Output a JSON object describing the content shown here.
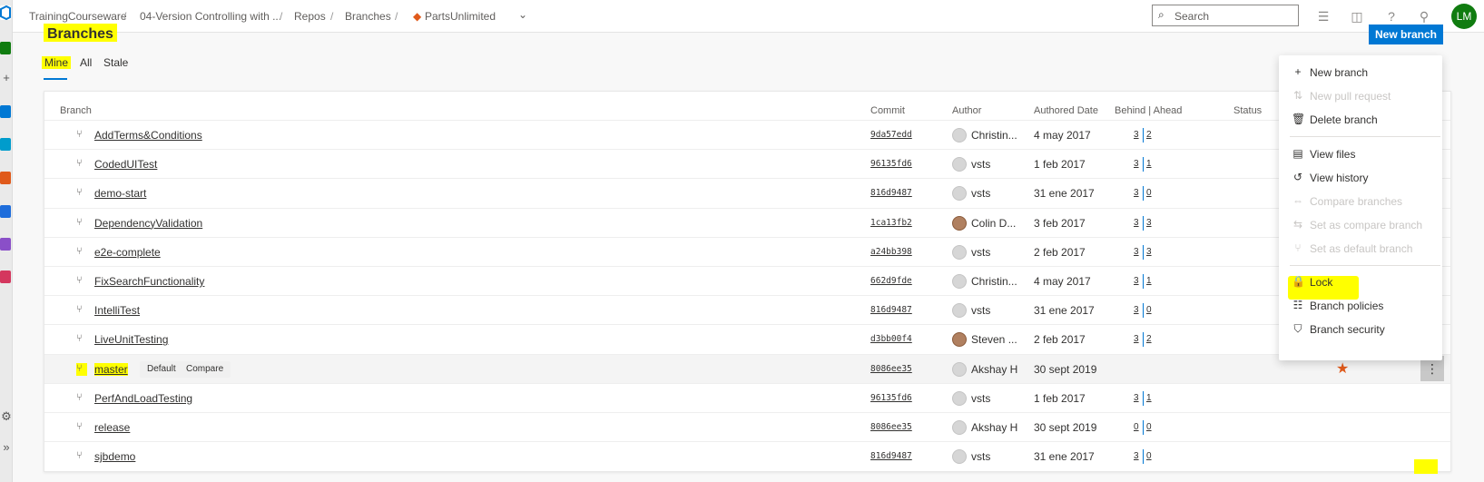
{
  "topbar": {
    "breadcrumbs": [
      "TrainingCourseware",
      "04-Version Controlling with ...",
      "Repos",
      "Branches",
      "PartsUnlimited"
    ],
    "search_placeholder": "Search",
    "user_initials": "LM"
  },
  "page": {
    "title": "Branches",
    "new_branch_label": "New branch",
    "tabs": [
      "Mine",
      "All",
      "Stale"
    ],
    "active_tab": "Mine"
  },
  "table": {
    "headers": [
      "Branch",
      "Commit",
      "Author",
      "Authored Date",
      "Behind | Ahead",
      "Status"
    ],
    "rows": [
      {
        "name": "AddTerms&Conditions",
        "commit": "9da57edd",
        "author": "Christin...",
        "date": "4 may 2017",
        "behind": "3",
        "ahead": "2"
      },
      {
        "name": "CodedUITest",
        "commit": "96135fd6",
        "author": "vsts",
        "date": "1 feb 2017",
        "behind": "3",
        "ahead": "1"
      },
      {
        "name": "demo-start",
        "commit": "816d9487",
        "author": "vsts",
        "date": "31 ene 2017",
        "behind": "3",
        "ahead": "0"
      },
      {
        "name": "DependencyValidation",
        "commit": "1ca13fb2",
        "author": "Colin D...",
        "date": "3 feb 2017",
        "behind": "3",
        "ahead": "3"
      },
      {
        "name": "e2e-complete",
        "commit": "a24bb398",
        "author": "vsts",
        "date": "2 feb 2017",
        "behind": "3",
        "ahead": "3"
      },
      {
        "name": "FixSearchFunctionality",
        "commit": "662d9fde",
        "author": "Christin...",
        "date": "4 may 2017",
        "behind": "3",
        "ahead": "1"
      },
      {
        "name": "IntelliTest",
        "commit": "816d9487",
        "author": "vsts",
        "date": "31 ene 2017",
        "behind": "3",
        "ahead": "0"
      },
      {
        "name": "LiveUnitTesting",
        "commit": "d3bb00f4",
        "author": "Steven ...",
        "date": "2 feb 2017",
        "behind": "3",
        "ahead": "2"
      },
      {
        "name": "master",
        "commit": "8086ee35",
        "author": "Akshay H",
        "date": "30 sept 2019",
        "behind": "",
        "ahead": "",
        "pills": [
          "Default",
          "Compare"
        ]
      },
      {
        "name": "PerfAndLoadTesting",
        "commit": "96135fd6",
        "author": "vsts",
        "date": "1 feb 2017",
        "behind": "3",
        "ahead": "1"
      },
      {
        "name": "release",
        "commit": "8086ee35",
        "author": "Akshay H",
        "date": "30 sept 2019",
        "behind": "0",
        "ahead": "0"
      },
      {
        "name": "sjbdemo",
        "commit": "816d9487",
        "author": "vsts",
        "date": "31 ene 2017",
        "behind": "3",
        "ahead": "0"
      }
    ]
  },
  "menu": {
    "items": [
      {
        "label": "New branch",
        "icon": "plus-icon",
        "disabled": false
      },
      {
        "label": "New pull request",
        "icon": "pull-request-icon",
        "disabled": true
      },
      {
        "label": "Delete branch",
        "icon": "trash-icon",
        "disabled": false
      },
      {
        "label": "View files",
        "icon": "file-icon",
        "disabled": false
      },
      {
        "label": "View history",
        "icon": "history-icon",
        "disabled": false
      },
      {
        "label": "Compare branches",
        "icon": "compare-icon",
        "disabled": true
      },
      {
        "label": "Set as compare branch",
        "icon": "compare-set-icon",
        "disabled": true
      },
      {
        "label": "Set as default branch",
        "icon": "branch-icon",
        "disabled": true
      },
      {
        "label": "Lock",
        "icon": "lock-icon",
        "disabled": false
      },
      {
        "label": "Branch policies",
        "icon": "policy-icon",
        "disabled": false
      },
      {
        "label": "Branch security",
        "icon": "shield-icon",
        "disabled": false
      }
    ]
  },
  "colors": {
    "accent": "#0078d4",
    "highlight": "#ffff00",
    "star": "#e05a1b",
    "avatar": "#107c10"
  }
}
